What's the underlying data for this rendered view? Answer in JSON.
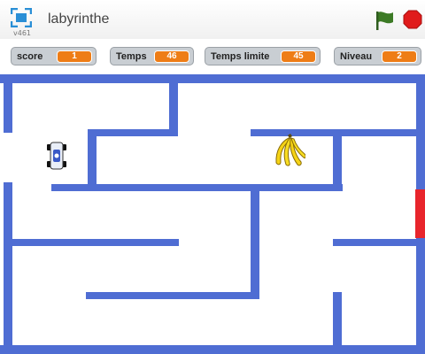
{
  "header": {
    "title": "labyrinthe",
    "version": "v461",
    "icons": {
      "fullscreen": "fullscreen-icon",
      "green_flag": "green-flag-icon",
      "stop": "stop-sign-icon"
    }
  },
  "monitors": [
    {
      "label": "score",
      "value": "1"
    },
    {
      "label": "Temps",
      "value": "46"
    },
    {
      "label": "Temps limite",
      "value": "45"
    },
    {
      "label": "Niveau",
      "value": "2"
    }
  ],
  "colors": {
    "wall": "#4f6dd3",
    "exit": "#e8252c",
    "monitor_value": "#ee7d16",
    "flag": "#3c7a25",
    "stop": "#e01b1b"
  },
  "sprites": {
    "player": "car-sprite",
    "goal": "banana-sprite"
  }
}
